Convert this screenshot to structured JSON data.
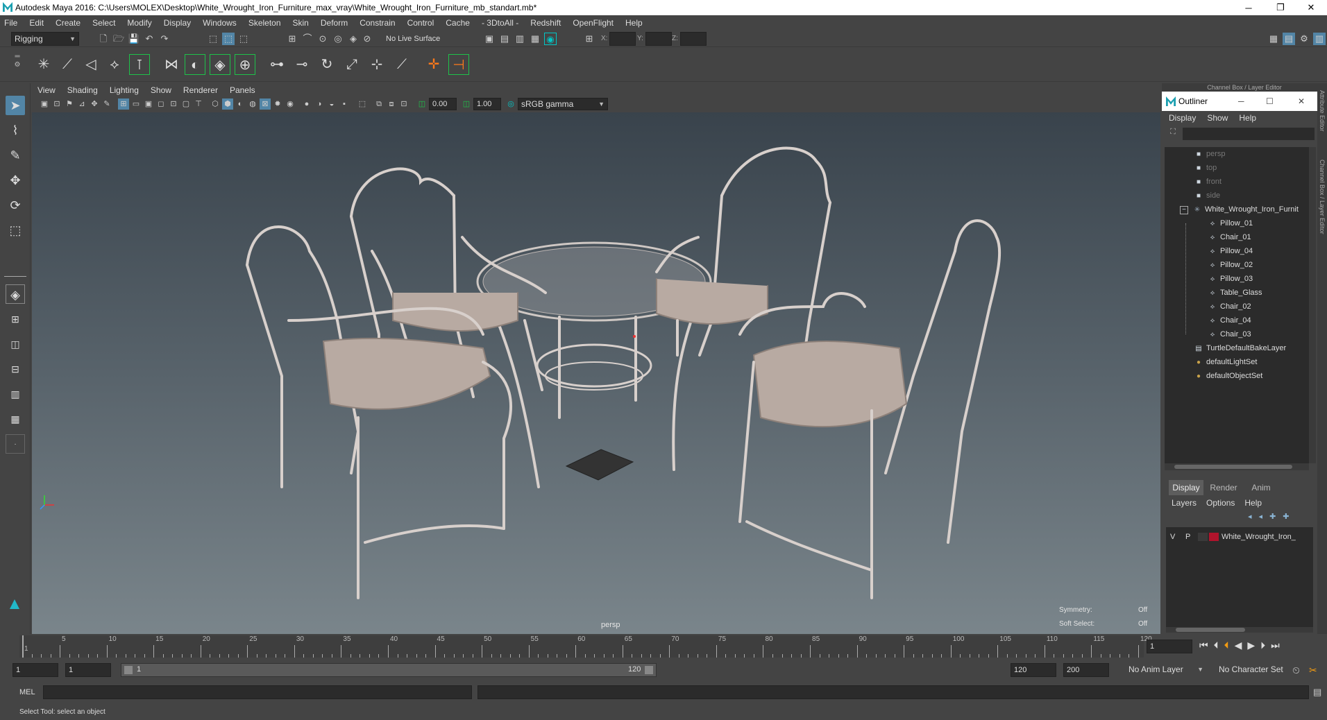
{
  "window": {
    "title": "Autodesk Maya 2016: C:\\Users\\MOLEX\\Desktop\\White_Wrought_Iron_Furniture_max_vray\\White_Wrought_Iron_Furniture_mb_standart.mb*",
    "minimize": "─",
    "restore": "❐",
    "close": "✕"
  },
  "menubar": [
    "File",
    "Edit",
    "Create",
    "Select",
    "Modify",
    "Display",
    "Windows",
    "Skeleton",
    "Skin",
    "Deform",
    "Constrain",
    "Control",
    "Cache",
    "- 3DtoAll -",
    "Redshift",
    "OpenFlight",
    "Help"
  ],
  "statusline": {
    "mode": "Rigging",
    "live_surface": "No Live Surface",
    "x_label": "X:",
    "y_label": "Y:",
    "z_label": "Z:"
  },
  "viewport": {
    "menu": [
      "View",
      "Shading",
      "Lighting",
      "Show",
      "Renderer",
      "Panels"
    ],
    "exposure": "0.00",
    "gamma": "1.00",
    "color_space": "sRGB gamma",
    "camera_label": "persp",
    "symmetry_label": "Symmetry:",
    "symmetry_value": "Off",
    "soft_select_label": "Soft Select:",
    "soft_select_value": "Off"
  },
  "panel_header": "Channel Box / Layer Editor",
  "outliner": {
    "title": "Outliner",
    "menu": [
      "Display",
      "Show",
      "Help"
    ],
    "items": [
      {
        "label": "persp",
        "type": "camera",
        "dim": true
      },
      {
        "label": "top",
        "type": "camera",
        "dim": true
      },
      {
        "label": "front",
        "type": "camera",
        "dim": true
      },
      {
        "label": "side",
        "type": "camera",
        "dim": true
      },
      {
        "label": "White_Wrought_Iron_Furnit",
        "type": "group",
        "dim": false
      },
      {
        "label": "Pillow_01",
        "type": "mesh",
        "dim": false
      },
      {
        "label": "Chair_01",
        "type": "mesh",
        "dim": false
      },
      {
        "label": "Pillow_04",
        "type": "mesh",
        "dim": false
      },
      {
        "label": "Pillow_02",
        "type": "mesh",
        "dim": false
      },
      {
        "label": "Pillow_03",
        "type": "mesh",
        "dim": false
      },
      {
        "label": "Table_Glass",
        "type": "mesh",
        "dim": false
      },
      {
        "label": "Chair_02",
        "type": "mesh",
        "dim": false
      },
      {
        "label": "Chair_04",
        "type": "mesh",
        "dim": false
      },
      {
        "label": "Chair_03",
        "type": "mesh",
        "dim": false
      },
      {
        "label": "TurtleDefaultBakeLayer",
        "type": "layer",
        "dim": false
      },
      {
        "label": "defaultLightSet",
        "type": "set",
        "dim": false
      },
      {
        "label": "defaultObjectSet",
        "type": "set",
        "dim": false
      }
    ]
  },
  "layer_editor": {
    "tabs": [
      "Display",
      "Render",
      "Anim"
    ],
    "menu": [
      "Layers",
      "Options",
      "Help"
    ],
    "layer": {
      "v": "V",
      "p": "P",
      "name": "White_Wrought_Iron_",
      "color": "#b0142c"
    }
  },
  "side_tabs": [
    "Attribute Editor",
    "Channel Box / Layer Editor"
  ],
  "timeline": {
    "ticks": [
      1,
      5,
      10,
      15,
      20,
      25,
      30,
      35,
      40,
      45,
      50,
      55,
      60,
      65,
      70,
      75,
      80,
      85,
      90,
      95,
      100,
      105,
      110,
      115,
      120
    ],
    "current_frame": "1"
  },
  "range": {
    "start": "1",
    "playback_start": "1",
    "slider_start": "1",
    "slider_end": "120",
    "playback_end": "120",
    "end": "200",
    "anim_layer": "No Anim Layer",
    "character_set": "No Character Set"
  },
  "cmdline": {
    "label": "MEL"
  },
  "helpline": "Select Tool: select an object",
  "colors": {
    "accent": "#5285a6",
    "highlight": "#00c7c7",
    "layer_red": "#b0142c"
  }
}
